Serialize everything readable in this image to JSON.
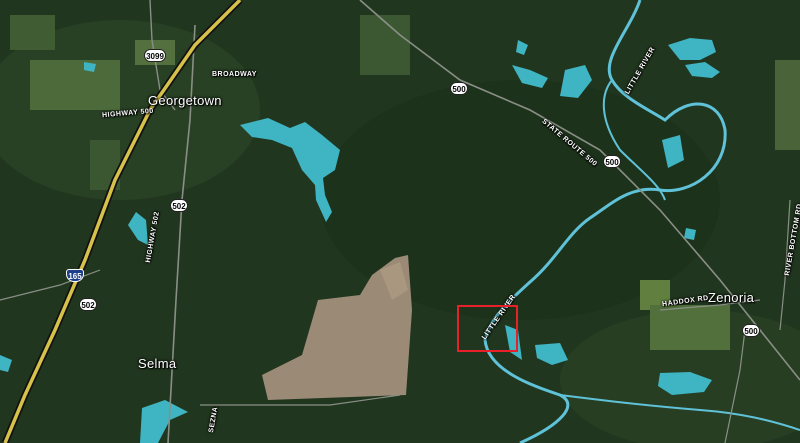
{
  "map": {
    "view": "satellite",
    "colors": {
      "forest": "#21361f",
      "water": "#3fb4c3",
      "river": "#5fc2d8",
      "highway": "#d6c24a",
      "clearing": "#9b8a76",
      "highlight": "#e8202a"
    },
    "places": {
      "georgetown": "Georgetown",
      "selma": "Selma",
      "zenoria": "Zenoria"
    },
    "roads": {
      "highway_500": "HIGHWAY 500",
      "broadway": "BROADWAY",
      "highway_502": "HIGHWAY 502",
      "state_route_500": "STATE ROUTE 500",
      "haddox_rd": "HADDOX RD",
      "river_bottom_rd": "RIVER BOTTOM RD",
      "sezna": "SEZNA"
    },
    "rivers": {
      "little_river_north": "LITTLE RIVER",
      "little_river_south": "LITTLE RIVER"
    },
    "shields": {
      "s3099": "3099",
      "s500_a": "500",
      "s500_b": "500",
      "s500_c": "500",
      "s502_a": "502",
      "s502_b": "502",
      "s165": "165"
    }
  }
}
